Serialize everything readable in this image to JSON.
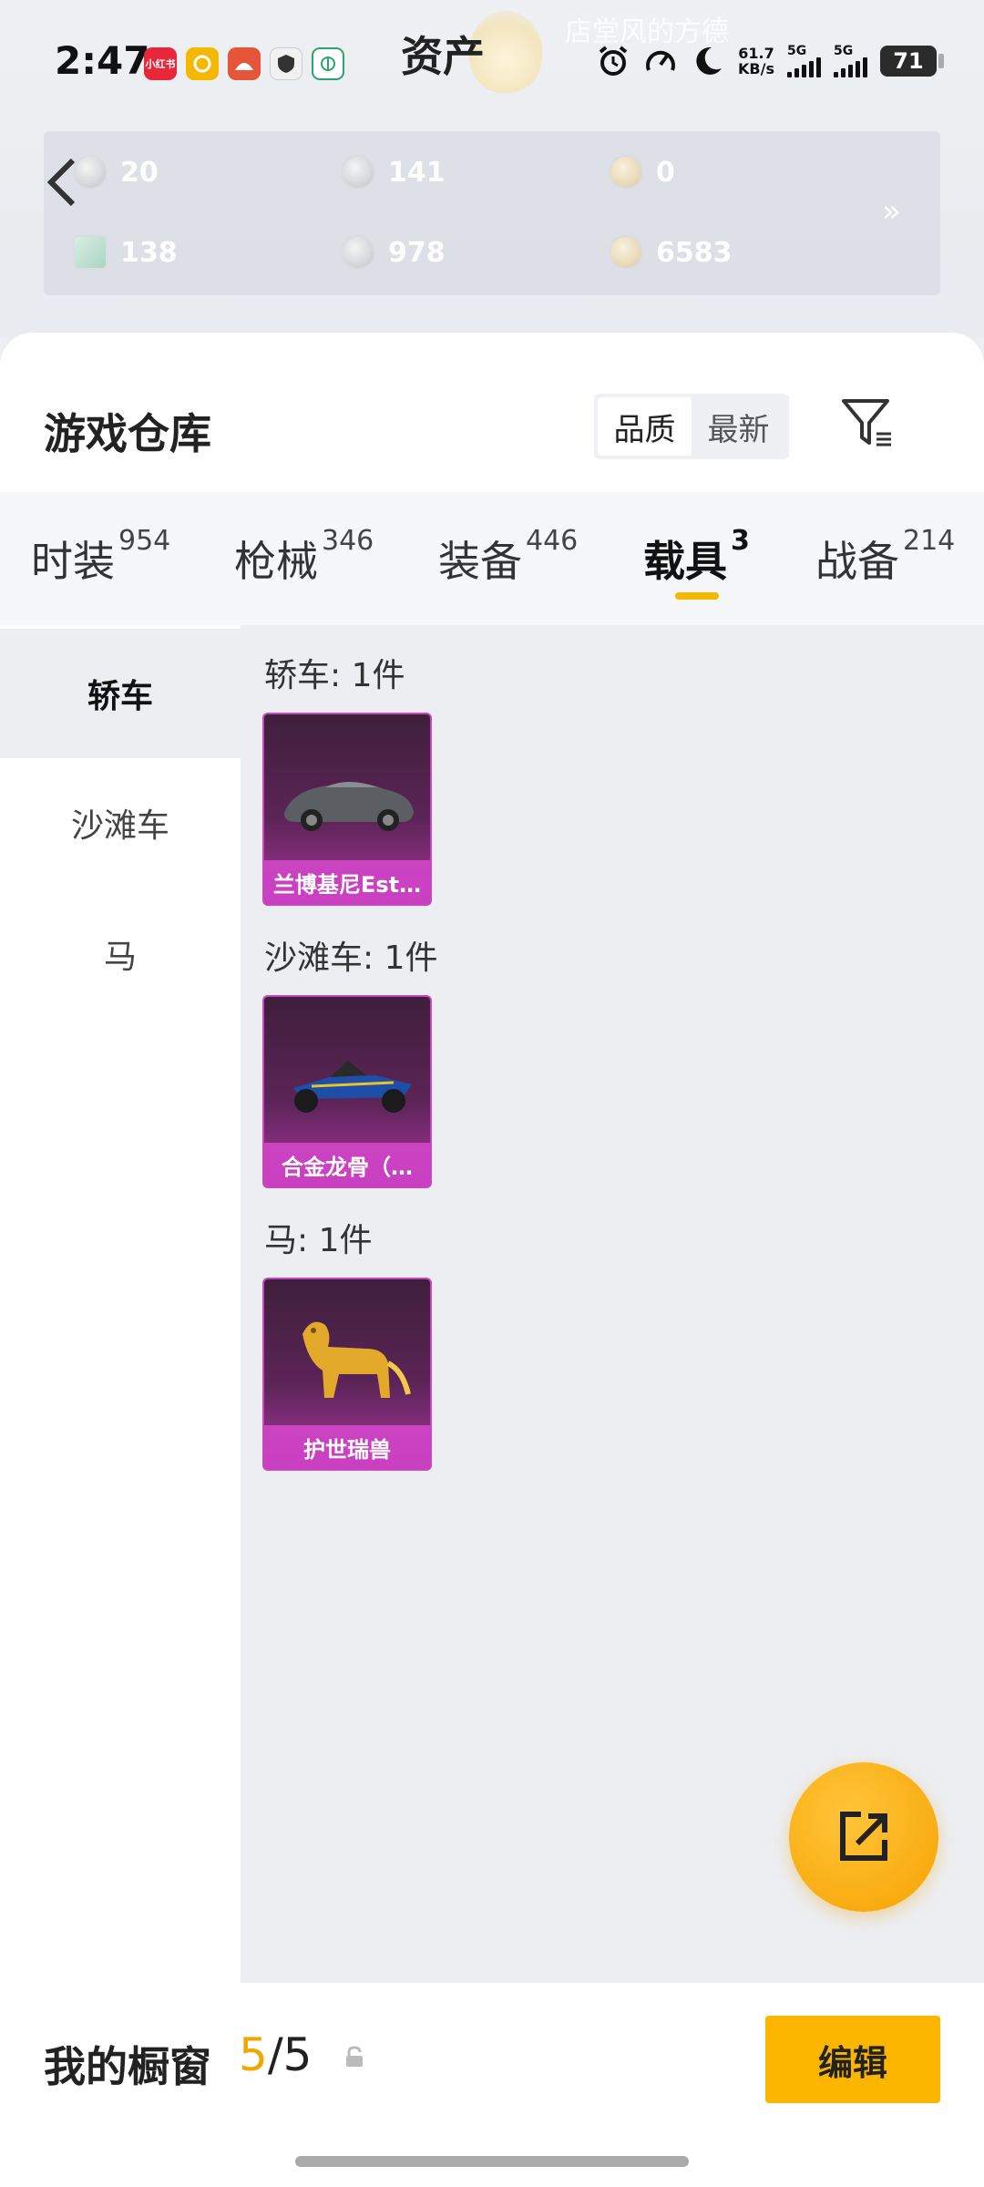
{
  "status_bar": {
    "time": "2:47",
    "net_speed_value": "61.7",
    "net_speed_unit": "KB/s",
    "sim1": "5G",
    "sim2": "5G",
    "battery": "71",
    "notif1": "小红书",
    "bg_text": "店堂风的方德"
  },
  "assets": {
    "title": "资产",
    "items": [
      {
        "value": "20"
      },
      {
        "value": "141"
      },
      {
        "value": "0"
      },
      {
        "value": "138"
      },
      {
        "value": "978"
      },
      {
        "value": "6583"
      }
    ],
    "more": "»"
  },
  "warehouse": {
    "title": "游戏仓库",
    "sort_quality": "品质",
    "sort_latest": "最新"
  },
  "tabs": [
    {
      "name": "时装",
      "count": "954"
    },
    {
      "name": "枪械",
      "count": "346"
    },
    {
      "name": "装备",
      "count": "446"
    },
    {
      "name": "载具",
      "count": "3"
    },
    {
      "name": "战备",
      "count": "214"
    }
  ],
  "categories": [
    {
      "label": "轿车"
    },
    {
      "label": "沙滩车"
    },
    {
      "label": "马"
    }
  ],
  "sections": [
    {
      "title": "轿车: 1件",
      "item": "兰博基尼Est…"
    },
    {
      "title": "沙滩车: 1件",
      "item": "合金龙骨（…"
    },
    {
      "title": "马: 1件",
      "item": "护世瑞兽"
    }
  ],
  "showcase": {
    "title": "我的橱窗",
    "current": "5",
    "separator": "/",
    "total": "5",
    "edit_label": "编辑"
  },
  "colors": {
    "accent": "#f5b800",
    "card_purple": "#c847c0"
  }
}
